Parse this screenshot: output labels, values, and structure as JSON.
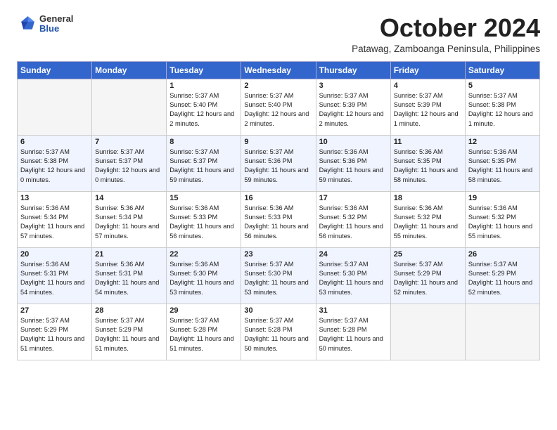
{
  "header": {
    "logo_general": "General",
    "logo_blue": "Blue",
    "month_title": "October 2024",
    "subtitle": "Patawag, Zamboanga Peninsula, Philippines"
  },
  "weekdays": [
    "Sunday",
    "Monday",
    "Tuesday",
    "Wednesday",
    "Thursday",
    "Friday",
    "Saturday"
  ],
  "weeks": [
    [
      {
        "day": "",
        "sunrise": "",
        "sunset": "",
        "daylight": "",
        "empty": true
      },
      {
        "day": "",
        "sunrise": "",
        "sunset": "",
        "daylight": "",
        "empty": true
      },
      {
        "day": "1",
        "sunrise": "Sunrise: 5:37 AM",
        "sunset": "Sunset: 5:40 PM",
        "daylight": "Daylight: 12 hours and 2 minutes.",
        "empty": false
      },
      {
        "day": "2",
        "sunrise": "Sunrise: 5:37 AM",
        "sunset": "Sunset: 5:40 PM",
        "daylight": "Daylight: 12 hours and 2 minutes.",
        "empty": false
      },
      {
        "day": "3",
        "sunrise": "Sunrise: 5:37 AM",
        "sunset": "Sunset: 5:39 PM",
        "daylight": "Daylight: 12 hours and 2 minutes.",
        "empty": false
      },
      {
        "day": "4",
        "sunrise": "Sunrise: 5:37 AM",
        "sunset": "Sunset: 5:39 PM",
        "daylight": "Daylight: 12 hours and 1 minute.",
        "empty": false
      },
      {
        "day": "5",
        "sunrise": "Sunrise: 5:37 AM",
        "sunset": "Sunset: 5:38 PM",
        "daylight": "Daylight: 12 hours and 1 minute.",
        "empty": false
      }
    ],
    [
      {
        "day": "6",
        "sunrise": "Sunrise: 5:37 AM",
        "sunset": "Sunset: 5:38 PM",
        "daylight": "Daylight: 12 hours and 0 minutes.",
        "empty": false
      },
      {
        "day": "7",
        "sunrise": "Sunrise: 5:37 AM",
        "sunset": "Sunset: 5:37 PM",
        "daylight": "Daylight: 12 hours and 0 minutes.",
        "empty": false
      },
      {
        "day": "8",
        "sunrise": "Sunrise: 5:37 AM",
        "sunset": "Sunset: 5:37 PM",
        "daylight": "Daylight: 11 hours and 59 minutes.",
        "empty": false
      },
      {
        "day": "9",
        "sunrise": "Sunrise: 5:37 AM",
        "sunset": "Sunset: 5:36 PM",
        "daylight": "Daylight: 11 hours and 59 minutes.",
        "empty": false
      },
      {
        "day": "10",
        "sunrise": "Sunrise: 5:36 AM",
        "sunset": "Sunset: 5:36 PM",
        "daylight": "Daylight: 11 hours and 59 minutes.",
        "empty": false
      },
      {
        "day": "11",
        "sunrise": "Sunrise: 5:36 AM",
        "sunset": "Sunset: 5:35 PM",
        "daylight": "Daylight: 11 hours and 58 minutes.",
        "empty": false
      },
      {
        "day": "12",
        "sunrise": "Sunrise: 5:36 AM",
        "sunset": "Sunset: 5:35 PM",
        "daylight": "Daylight: 11 hours and 58 minutes.",
        "empty": false
      }
    ],
    [
      {
        "day": "13",
        "sunrise": "Sunrise: 5:36 AM",
        "sunset": "Sunset: 5:34 PM",
        "daylight": "Daylight: 11 hours and 57 minutes.",
        "empty": false
      },
      {
        "day": "14",
        "sunrise": "Sunrise: 5:36 AM",
        "sunset": "Sunset: 5:34 PM",
        "daylight": "Daylight: 11 hours and 57 minutes.",
        "empty": false
      },
      {
        "day": "15",
        "sunrise": "Sunrise: 5:36 AM",
        "sunset": "Sunset: 5:33 PM",
        "daylight": "Daylight: 11 hours and 56 minutes.",
        "empty": false
      },
      {
        "day": "16",
        "sunrise": "Sunrise: 5:36 AM",
        "sunset": "Sunset: 5:33 PM",
        "daylight": "Daylight: 11 hours and 56 minutes.",
        "empty": false
      },
      {
        "day": "17",
        "sunrise": "Sunrise: 5:36 AM",
        "sunset": "Sunset: 5:32 PM",
        "daylight": "Daylight: 11 hours and 56 minutes.",
        "empty": false
      },
      {
        "day": "18",
        "sunrise": "Sunrise: 5:36 AM",
        "sunset": "Sunset: 5:32 PM",
        "daylight": "Daylight: 11 hours and 55 minutes.",
        "empty": false
      },
      {
        "day": "19",
        "sunrise": "Sunrise: 5:36 AM",
        "sunset": "Sunset: 5:32 PM",
        "daylight": "Daylight: 11 hours and 55 minutes.",
        "empty": false
      }
    ],
    [
      {
        "day": "20",
        "sunrise": "Sunrise: 5:36 AM",
        "sunset": "Sunset: 5:31 PM",
        "daylight": "Daylight: 11 hours and 54 minutes.",
        "empty": false
      },
      {
        "day": "21",
        "sunrise": "Sunrise: 5:36 AM",
        "sunset": "Sunset: 5:31 PM",
        "daylight": "Daylight: 11 hours and 54 minutes.",
        "empty": false
      },
      {
        "day": "22",
        "sunrise": "Sunrise: 5:36 AM",
        "sunset": "Sunset: 5:30 PM",
        "daylight": "Daylight: 11 hours and 53 minutes.",
        "empty": false
      },
      {
        "day": "23",
        "sunrise": "Sunrise: 5:37 AM",
        "sunset": "Sunset: 5:30 PM",
        "daylight": "Daylight: 11 hours and 53 minutes.",
        "empty": false
      },
      {
        "day": "24",
        "sunrise": "Sunrise: 5:37 AM",
        "sunset": "Sunset: 5:30 PM",
        "daylight": "Daylight: 11 hours and 53 minutes.",
        "empty": false
      },
      {
        "day": "25",
        "sunrise": "Sunrise: 5:37 AM",
        "sunset": "Sunset: 5:29 PM",
        "daylight": "Daylight: 11 hours and 52 minutes.",
        "empty": false
      },
      {
        "day": "26",
        "sunrise": "Sunrise: 5:37 AM",
        "sunset": "Sunset: 5:29 PM",
        "daylight": "Daylight: 11 hours and 52 minutes.",
        "empty": false
      }
    ],
    [
      {
        "day": "27",
        "sunrise": "Sunrise: 5:37 AM",
        "sunset": "Sunset: 5:29 PM",
        "daylight": "Daylight: 11 hours and 51 minutes.",
        "empty": false
      },
      {
        "day": "28",
        "sunrise": "Sunrise: 5:37 AM",
        "sunset": "Sunset: 5:29 PM",
        "daylight": "Daylight: 11 hours and 51 minutes.",
        "empty": false
      },
      {
        "day": "29",
        "sunrise": "Sunrise: 5:37 AM",
        "sunset": "Sunset: 5:28 PM",
        "daylight": "Daylight: 11 hours and 51 minutes.",
        "empty": false
      },
      {
        "day": "30",
        "sunrise": "Sunrise: 5:37 AM",
        "sunset": "Sunset: 5:28 PM",
        "daylight": "Daylight: 11 hours and 50 minutes.",
        "empty": false
      },
      {
        "day": "31",
        "sunrise": "Sunrise: 5:37 AM",
        "sunset": "Sunset: 5:28 PM",
        "daylight": "Daylight: 11 hours and 50 minutes.",
        "empty": false
      },
      {
        "day": "",
        "sunrise": "",
        "sunset": "",
        "daylight": "",
        "empty": true
      },
      {
        "day": "",
        "sunrise": "",
        "sunset": "",
        "daylight": "",
        "empty": true
      }
    ]
  ]
}
